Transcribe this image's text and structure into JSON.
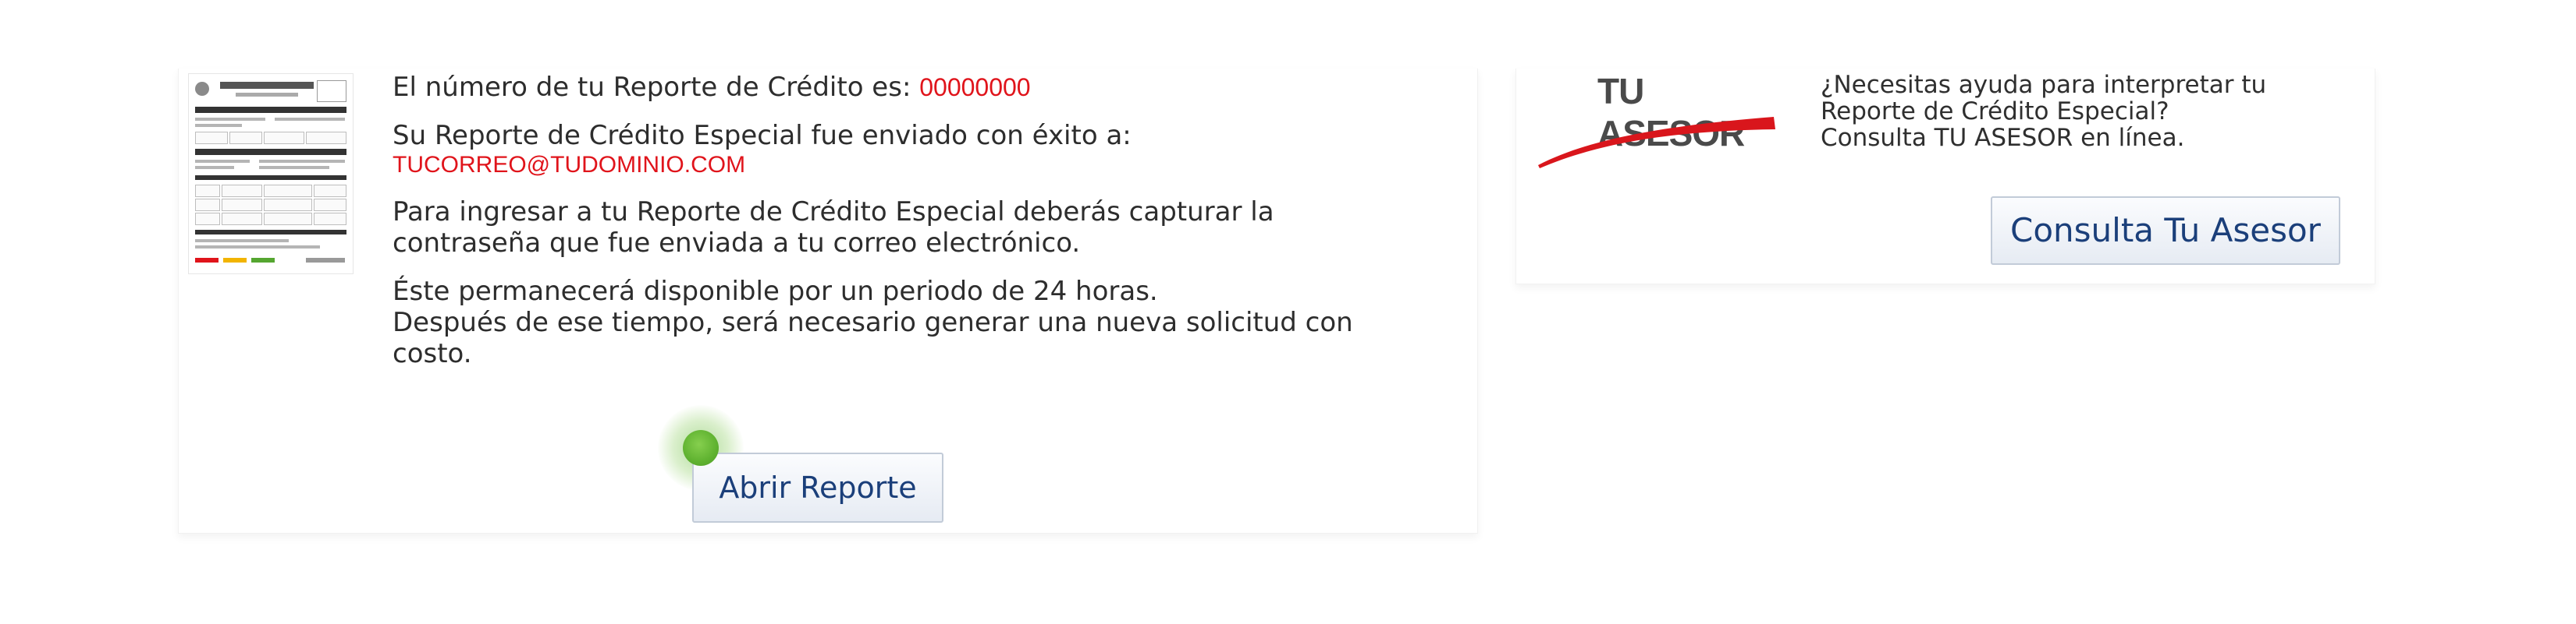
{
  "report": {
    "number_label": "El número de tu Reporte de Crédito es:",
    "number_value": "00000000",
    "sent_label": "Su Reporte de Crédito Especial fue enviado con éxito a:",
    "email": "TUCORREO@TUDOMINIO.COM",
    "password_line1": "Para ingresar a tu Reporte de Crédito Especial deberás capturar la",
    "password_line2": "contraseña que fue enviada a tu correo electrónico.",
    "availability_line1": "Éste permanecerá disponible por un periodo de 24 horas.",
    "availability_line2": "Después de ese tiempo, será necesario generar una nueva solicitud con",
    "availability_line3": "costo.",
    "open_button": "Abrir Reporte"
  },
  "asesor": {
    "logo_text": "TU ASESOR",
    "help_line1": "¿Necesitas ayuda para interpretar tu",
    "help_line2": "Reporte de Crédito Especial?",
    "help_line3": "Consulta TU ASESOR en línea.",
    "button": "Consulta Tu Asesor"
  },
  "colors": {
    "accent_red": "#e0141b",
    "button_text": "#1b3f7a",
    "click_indicator": "#5fb230"
  },
  "icons": {
    "report_thumbnail": "report-thumbnail-icon",
    "asesor_swoosh": "red-swoosh-icon"
  }
}
